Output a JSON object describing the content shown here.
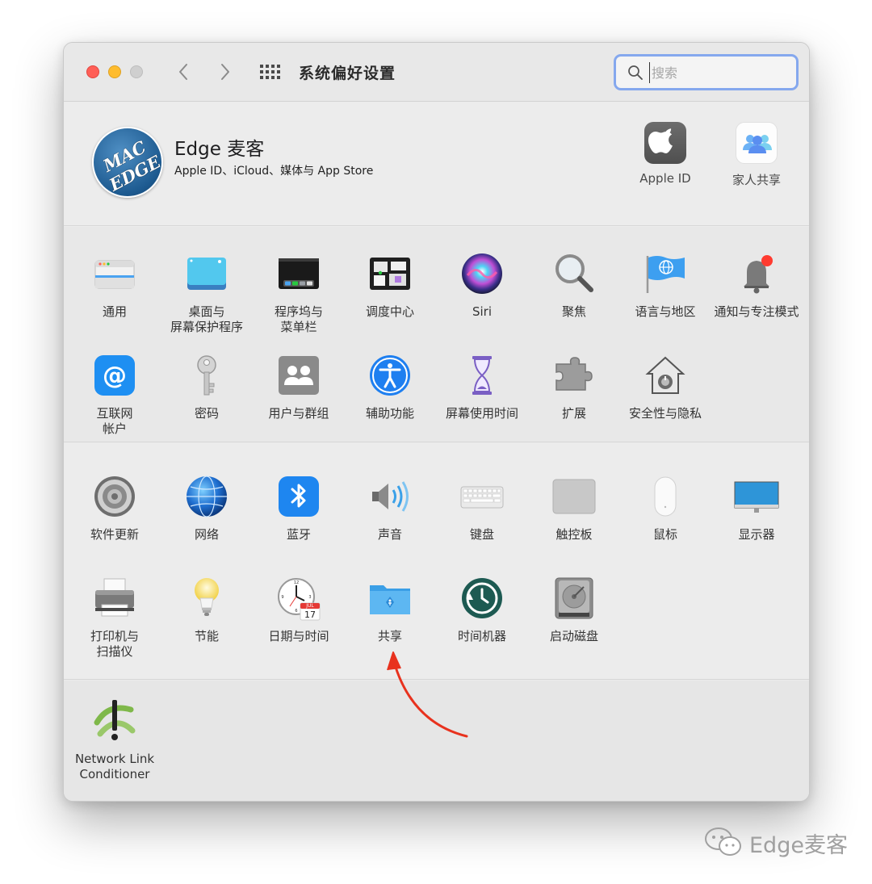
{
  "window": {
    "title": "系统偏好设置",
    "search_placeholder": "搜索"
  },
  "account": {
    "avatar_top": "MAC",
    "avatar_bottom": "EDGE",
    "name": "Edge 麦客",
    "subtitle": "Apple ID、iCloud、媒体与 App Store",
    "buttons": [
      {
        "label": "Apple ID",
        "icon": "apple-logo-icon"
      },
      {
        "label": "家人共享",
        "icon": "family-sharing-icon"
      }
    ]
  },
  "personal_prefs": [
    {
      "label": "通用",
      "icon": "general-icon"
    },
    {
      "label": "桌面与\n屏幕保护程序",
      "icon": "desktop-screensaver-icon"
    },
    {
      "label": "程序坞与\n菜单栏",
      "icon": "dock-menubar-icon"
    },
    {
      "label": "调度中心",
      "icon": "mission-control-icon"
    },
    {
      "label": "Siri",
      "icon": "siri-icon"
    },
    {
      "label": "聚焦",
      "icon": "spotlight-icon"
    },
    {
      "label": "语言与地区",
      "icon": "language-region-icon"
    },
    {
      "label": "通知与专注模式",
      "icon": "notifications-icon"
    },
    {
      "label": "互联网\n帐户",
      "icon": "internet-accounts-icon"
    },
    {
      "label": "密码",
      "icon": "passwords-icon"
    },
    {
      "label": "用户与群组",
      "icon": "users-groups-icon"
    },
    {
      "label": "辅助功能",
      "icon": "accessibility-icon"
    },
    {
      "label": "屏幕使用时间",
      "icon": "screen-time-icon"
    },
    {
      "label": "扩展",
      "icon": "extensions-icon"
    },
    {
      "label": "安全性与隐私",
      "icon": "security-privacy-icon"
    }
  ],
  "hardware_prefs": [
    {
      "label": "软件更新",
      "icon": "software-update-icon"
    },
    {
      "label": "网络",
      "icon": "network-icon"
    },
    {
      "label": "蓝牙",
      "icon": "bluetooth-icon"
    },
    {
      "label": "声音",
      "icon": "sound-icon"
    },
    {
      "label": "键盘",
      "icon": "keyboard-icon"
    },
    {
      "label": "触控板",
      "icon": "trackpad-icon"
    },
    {
      "label": "鼠标",
      "icon": "mouse-icon"
    },
    {
      "label": "显示器",
      "icon": "displays-icon"
    },
    {
      "label": "打印机与\n扫描仪",
      "icon": "printers-scanners-icon"
    },
    {
      "label": "节能",
      "icon": "energy-saver-icon"
    },
    {
      "label": "日期与时间",
      "icon": "date-time-icon"
    },
    {
      "label": "共享",
      "icon": "sharing-icon"
    },
    {
      "label": "时间机器",
      "icon": "time-machine-icon"
    },
    {
      "label": "启动磁盘",
      "icon": "startup-disk-icon"
    }
  ],
  "date_icon": {
    "month": "JUL",
    "day": "17"
  },
  "other_prefs": [
    {
      "label": "Network Link\nConditioner",
      "icon": "network-link-conditioner-icon"
    }
  ],
  "watermark": "Edge麦客",
  "colors": {
    "accent_arrow": "#e8321e",
    "search_focus": "#85a8ee"
  }
}
